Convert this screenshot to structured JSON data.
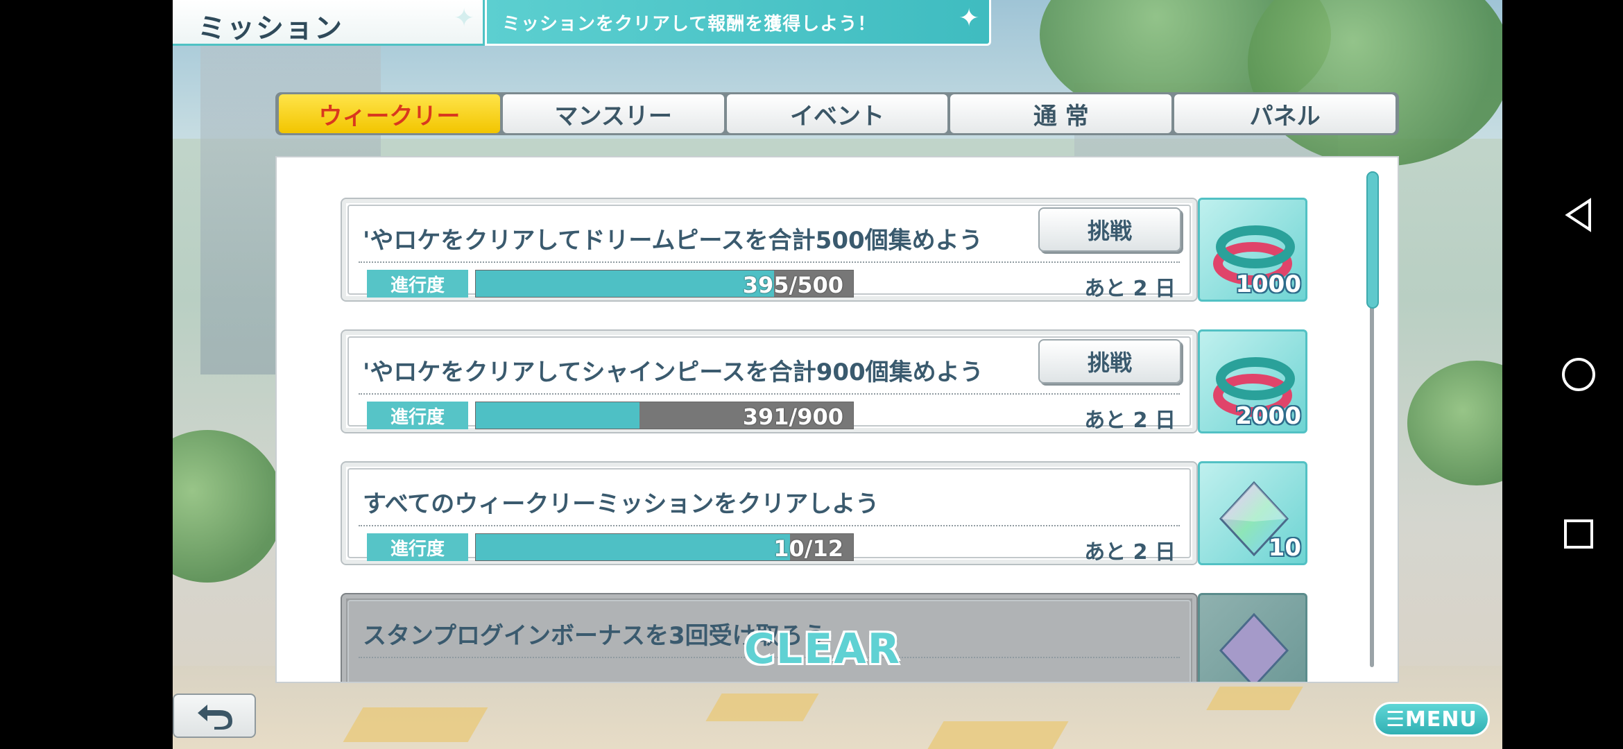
{
  "header": {
    "title": "ミッション",
    "subtitle": "ミッションをクリアして報酬を獲得しよう！"
  },
  "tabs": [
    {
      "label": "ウィークリー",
      "active": true
    },
    {
      "label": "マンスリー",
      "active": false
    },
    {
      "label": "イベント",
      "active": false
    },
    {
      "label": "通 常",
      "active": false
    },
    {
      "label": "パネル",
      "active": false
    }
  ],
  "missions": [
    {
      "text": "'やロケをクリアしてドリームピースを合計500個集めよう",
      "progress_label": "進行度",
      "progress_text": "395/500",
      "progress_fraction": 0.79,
      "remaining": "あと 2 日",
      "button": "挑戦",
      "reward_icon": "wristband-icon",
      "reward_qty": "1000"
    },
    {
      "text": "'やロケをクリアしてシャインピースを合計900個集めよう",
      "progress_label": "進行度",
      "progress_text": "391/900",
      "progress_fraction": 0.434,
      "remaining": "あと 2 日",
      "button": "挑戦",
      "reward_icon": "wristband-icon",
      "reward_qty": "2000"
    },
    {
      "text": "すべてのウィークリーミッションをクリアしよう",
      "progress_label": "進行度",
      "progress_text": "10/12",
      "progress_fraction": 0.833,
      "remaining": "あと 2 日",
      "reward_icon": "crystal-icon",
      "reward_qty": "10"
    },
    {
      "text": "スタンプログインボーナスを3回受け取ろう",
      "status": "CLEAR",
      "reward_icon": "crystal-icon"
    }
  ],
  "buttons": {
    "menu": "☰MENU",
    "back_icon": "back-arrow-icon"
  },
  "colors": {
    "accent": "#4ec0c5",
    "tab_active": "#f2c500",
    "tab_active_text": "#d9381e",
    "text_main": "#3a5a6e"
  }
}
